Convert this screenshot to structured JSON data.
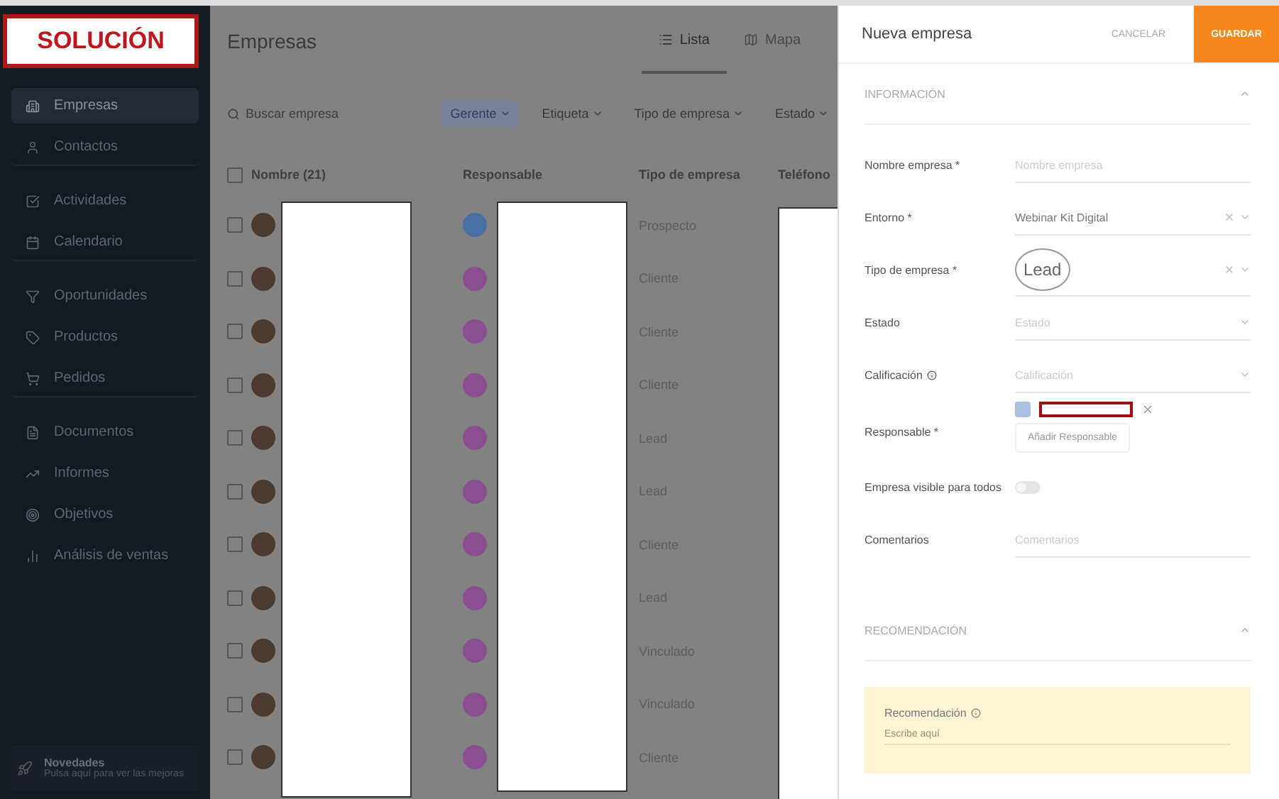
{
  "stamp": "SOLUCIÓN",
  "sidebar": {
    "items": [
      {
        "label": "Empresas",
        "selected": true
      },
      {
        "label": "Contactos",
        "selected": false,
        "divider": true
      },
      {
        "label": "Actividades",
        "selected": false
      },
      {
        "label": "Calendario",
        "selected": false,
        "divider": true
      },
      {
        "label": "Oportunidades",
        "selected": false
      },
      {
        "label": "Productos",
        "selected": false
      },
      {
        "label": "Pedidos",
        "selected": false,
        "divider": true
      },
      {
        "label": "Documentos",
        "selected": false
      },
      {
        "label": "Informes",
        "selected": false
      },
      {
        "label": "Objetivos",
        "selected": false
      },
      {
        "label": "Análisis de ventas",
        "selected": false
      }
    ],
    "footer": {
      "title": "Novedades",
      "subtitle": "Pulsa aquí para ver las mejoras"
    }
  },
  "list": {
    "title": "Empresas",
    "views": [
      {
        "label": "Lista",
        "selected": true
      },
      {
        "label": "Mapa",
        "selected": false
      }
    ],
    "search": {
      "placeholder": "Buscar empresa"
    },
    "filters": [
      {
        "label": "Gerente",
        "active": true
      },
      {
        "label": "Etiqueta",
        "active": false
      },
      {
        "label": "Tipo de empresa",
        "active": false
      },
      {
        "label": "Estado",
        "active": false
      }
    ],
    "select_all": {
      "checked": false
    },
    "columns": [
      "Nombre (21)",
      "Responsable",
      "Tipo de empresa",
      "Teléfono"
    ],
    "rows": [
      {
        "type": "Prospecto",
        "checked": false,
        "color": "#4a6fa5"
      },
      {
        "type": "Cliente",
        "checked": false,
        "color": "#8a4f8f"
      },
      {
        "type": "Cliente",
        "checked": false,
        "color": "#8a4f8f"
      },
      {
        "type": "Cliente",
        "checked": false,
        "color": "#8a4f8f"
      },
      {
        "type": "Lead",
        "checked": false,
        "color": "#8a4f8f"
      },
      {
        "type": "Lead",
        "checked": false,
        "color": "#8a4f8f"
      },
      {
        "type": "Cliente",
        "checked": false,
        "color": "#8a4f8f"
      },
      {
        "type": "Lead",
        "checked": false,
        "color": "#8a4f8f"
      },
      {
        "type": "Vinculado",
        "checked": false,
        "color": "#8a4f8f"
      },
      {
        "type": "Vinculado",
        "checked": false,
        "color": "#8a4f8f"
      },
      {
        "type": "Cliente",
        "checked": false,
        "color": "#8a4f8f"
      }
    ]
  },
  "panel": {
    "title": "Nueva empresa",
    "cancel": "CANCELAR",
    "save": "GUARDAR",
    "sections": [
      {
        "title": "INFORMACIÓN",
        "expanded": true,
        "fields": [
          {
            "kind": "text",
            "label": "Nombre empresa *",
            "placeholder": "Nombre empresa"
          },
          {
            "kind": "select",
            "label": "Entorno *",
            "value": "Webinar Kit Digital",
            "clearable": true
          },
          {
            "kind": "select",
            "label": "Tipo de empresa *",
            "value": "Lead",
            "clearable": true,
            "circled": true
          },
          {
            "kind": "select",
            "label": "Estado",
            "placeholder": "Estado"
          },
          {
            "kind": "select",
            "label": "Calificación",
            "info": true,
            "placeholder": "Calificación"
          },
          {
            "kind": "owner",
            "label": "Responsable *",
            "button": "Añadir Responsable"
          },
          {
            "kind": "toggle",
            "label": "Empresa visible para todos",
            "on": false
          },
          {
            "kind": "textarea",
            "label": "Comentarios",
            "placeholder": "Comentarios"
          }
        ]
      },
      {
        "title": "RECOMENDACIÓN",
        "expanded": true,
        "note": {
          "label": "Recomendación",
          "placeholder": "Escribe aquí"
        }
      }
    ]
  }
}
